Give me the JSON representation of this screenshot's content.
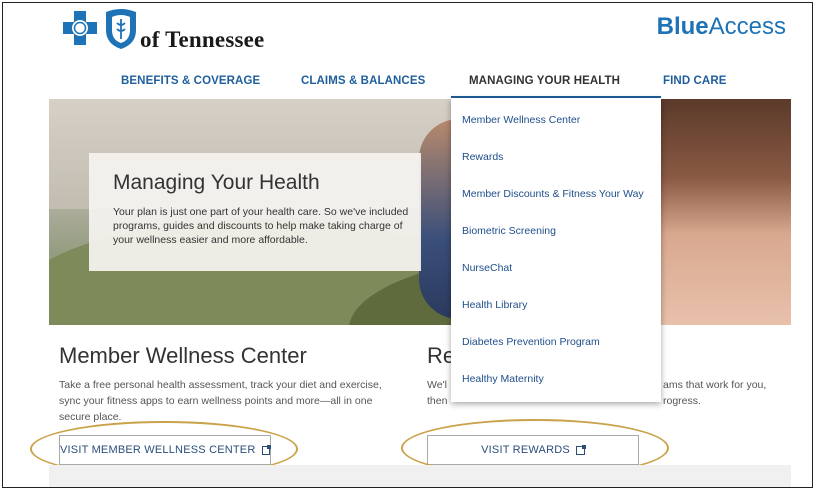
{
  "brand": {
    "logo_text": "of Tennessee",
    "app_name_bold": "Blue",
    "app_name_light": "Access"
  },
  "nav": {
    "items": [
      {
        "label": "BENEFITS & COVERAGE"
      },
      {
        "label": "CLAIMS & BALANCES"
      },
      {
        "label": "MANAGING YOUR HEALTH"
      },
      {
        "label": "FIND CARE"
      }
    ]
  },
  "hero": {
    "title": "Managing Your Health",
    "body": "Your plan is just one part of your health care. So we've included programs, guides and discounts to help make taking charge of your wellness easier and more affordable."
  },
  "dropdown": {
    "items": [
      {
        "label": "Member Wellness Center"
      },
      {
        "label": "Rewards"
      },
      {
        "label": "Member Discounts & Fitness Your Way"
      },
      {
        "label": "Biometric Screening"
      },
      {
        "label": "NurseChat"
      },
      {
        "label": "Health Library"
      },
      {
        "label": "Diabetes Prevention Program"
      },
      {
        "label": "Healthy Maternity"
      }
    ]
  },
  "wellness": {
    "title": "Member Wellness Center",
    "body": "Take a free personal health assessment, track your diet and exercise, sync your fitness apps to earn wellness points and more—all in one secure place.",
    "button": "VISIT MEMBER WELLNESS CENTER"
  },
  "rewards": {
    "title_partial": "Re",
    "body_left_line1": "We'l",
    "body_left_line2": "then",
    "body_right_line1": "ams that work for you,",
    "body_right_line2": "rogress.",
    "button": "VISIT REWARDS"
  },
  "colors": {
    "brand_blue": "#1d73b6",
    "nav_blue": "#1f5e9c",
    "annotation_gold": "#c9a24a"
  }
}
